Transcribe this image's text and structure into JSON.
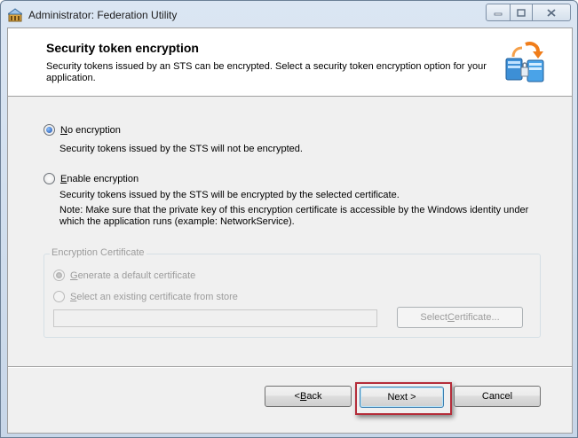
{
  "window": {
    "title": "Administrator: Federation Utility",
    "controls": {
      "minimize_icon": "minimize-icon",
      "maximize_icon": "maximize-icon",
      "close_icon": "close-icon"
    }
  },
  "header": {
    "title": "Security token encryption",
    "description": "Security tokens issued by an STS can be encrypted. Select a security token encryption option for your application.",
    "icon": "encryption-servers-icon"
  },
  "options": {
    "no_encryption": {
      "label": "No encryption",
      "mnemonic": "N",
      "label_rest": "o encryption",
      "selected": true,
      "description": "Security tokens issued by the STS will not be encrypted."
    },
    "enable_encryption": {
      "label": "Enable encryption",
      "mnemonic": "E",
      "label_rest": "nable encryption",
      "selected": false,
      "description": "Security tokens issued by the STS will be encrypted by the selected certificate.",
      "note": "Note: Make sure that the private key of this encryption certificate is accessible by the Windows identity under which the application runs (example: NetworkService)."
    }
  },
  "certificate_group": {
    "label": "Encryption Certificate",
    "generate": {
      "mnemonic": "G",
      "label_rest": "enerate a default certificate",
      "selected": true,
      "enabled": false
    },
    "select_existing": {
      "mnemonic": "S",
      "label_rest": "elect an existing certificate from store",
      "selected": false,
      "enabled": false
    },
    "certificate_value": "",
    "select_button": {
      "before": "Select ",
      "mnemonic": "C",
      "after": "ertificate..."
    }
  },
  "buttons": {
    "back": {
      "before": "< ",
      "mnemonic": "B",
      "after": "ack"
    },
    "next": "Next >",
    "cancel": "Cancel"
  },
  "colors": {
    "highlight_border": "#b42d3a",
    "title_text": "#1c1c1c",
    "disabled_text": "#9c9c9c"
  }
}
